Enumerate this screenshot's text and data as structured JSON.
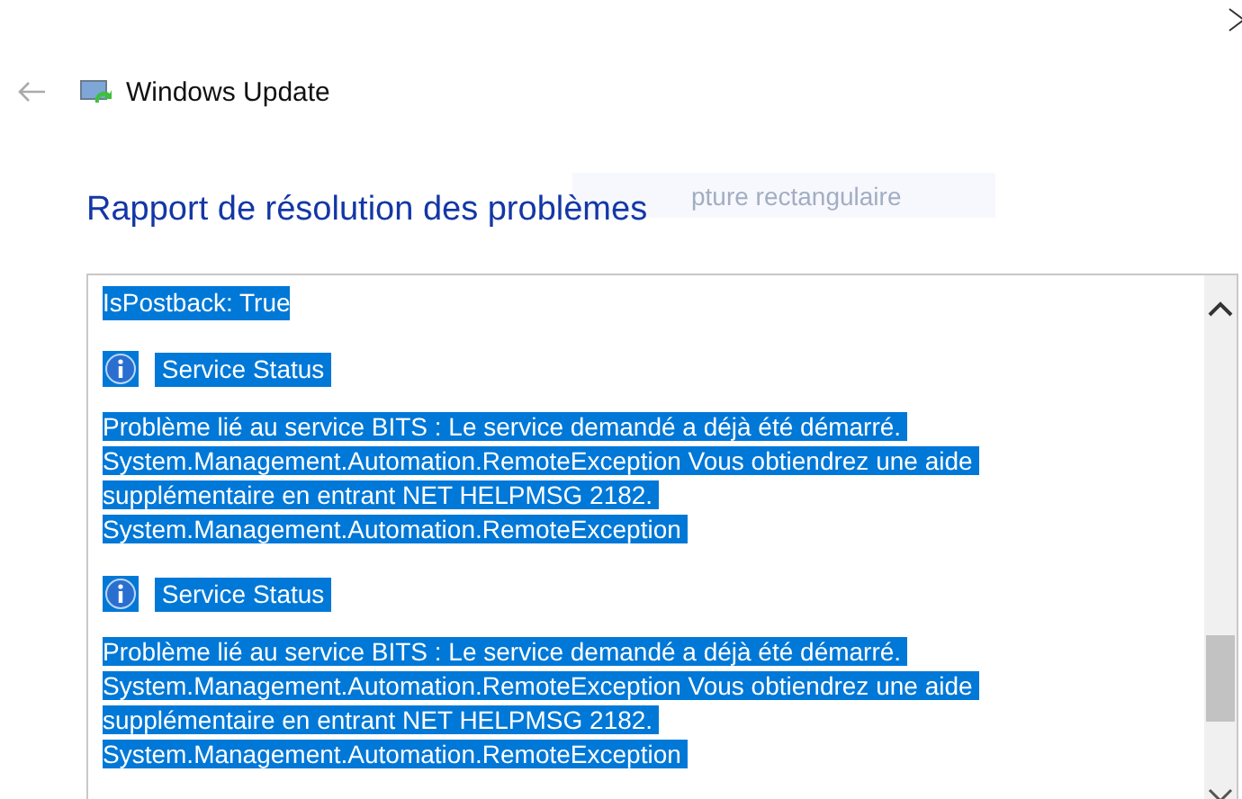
{
  "header": {
    "title": "Windows Update"
  },
  "heading": "Rapport de résolution des problèmes",
  "ghost_tooltip": "pture rectangulaire",
  "report": {
    "entries": [
      {
        "kind": "text",
        "text": "IsPostback: True",
        "selected": true
      },
      {
        "kind": "status",
        "text": "Service Status",
        "selected": true
      },
      {
        "kind": "message",
        "selected": true,
        "lines": [
          "Problème lié au service BITS : Le service demandé a déjà été démarré.",
          "System.Management.Automation.RemoteException Vous obtiendrez une aide",
          "supplémentaire en entrant NET HELPMSG 2182.",
          "System.Management.Automation.RemoteException"
        ]
      },
      {
        "kind": "status",
        "text": "Service Status",
        "selected": true
      },
      {
        "kind": "message",
        "selected": true,
        "lines": [
          "Problème lié au service BITS : Le service demandé a déjà été démarré.",
          "System.Management.Automation.RemoteException Vous obtiendrez une aide",
          "supplémentaire en entrant NET HELPMSG 2182.",
          "System.Management.Automation.RemoteException"
        ]
      }
    ]
  }
}
